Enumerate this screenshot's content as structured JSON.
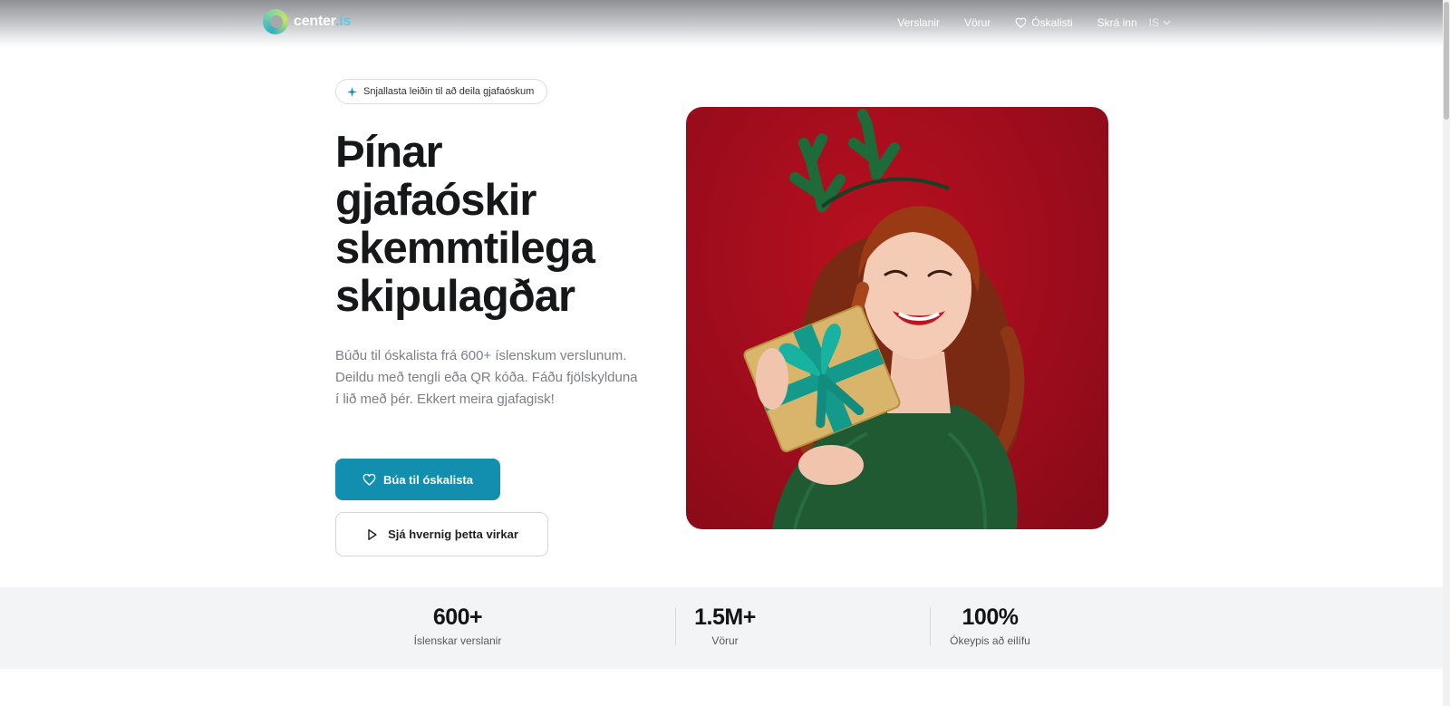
{
  "header": {
    "logo_text": "center",
    "logo_tld": ".is",
    "nav": {
      "stores": "Verslanir",
      "products": "Vörur",
      "wishlist": "Óskalisti",
      "login": "Skrá inn",
      "language": "IS"
    }
  },
  "hero": {
    "badge": "Snjallasta leiðin til að deila gjafaóskum",
    "title_lines": [
      "Þínar",
      "gjafaóskir",
      "skemmtilega",
      "skipulagðar"
    ],
    "description": "Búðu til óskalista frá 600+ íslenskum verslunum. Deildu með tengli eða QR kóða. Fáðu fjölskylduna í lið með þér. Ekkert meira gjafagisk!",
    "primary_button": "Búa til óskalista",
    "secondary_button": "Sjá hvernig þetta virkar"
  },
  "stats": [
    {
      "value": "600+",
      "label": "Íslenskar verslanir"
    },
    {
      "value": "1.5M+",
      "label": "Vörur"
    },
    {
      "value": "100%",
      "label": "Ókeypis að eilífu"
    }
  ],
  "colors": {
    "accent": "#128fae",
    "hero_background": "#a30d1d",
    "stats_background": "#f3f4f6"
  },
  "icons": {
    "badge": "sparkle-icon",
    "wishlist": "heart-icon",
    "secondary_button": "play-icon",
    "language": "chevron-down-icon"
  }
}
